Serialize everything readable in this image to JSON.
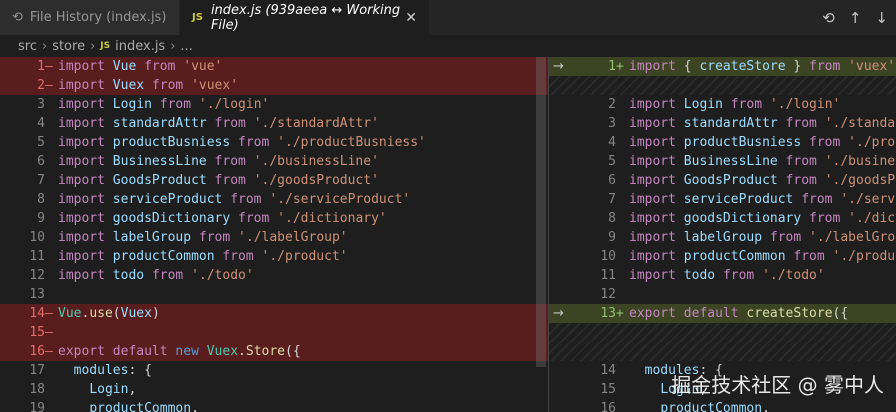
{
  "tabs": [
    {
      "label": "File History (index.js)",
      "icon": "history-icon",
      "active": false
    },
    {
      "label": "index.js (939aeea ↔ Working File)",
      "icon": "js-file-icon",
      "active": true
    }
  ],
  "breadcrumb": [
    "src",
    "store",
    "index.js",
    "..."
  ],
  "left_lines": [
    {
      "num": "1",
      "mark": "—",
      "type": "removed",
      "code": "import Vue from 'vue'"
    },
    {
      "num": "2",
      "mark": "—",
      "type": "removed",
      "code": "import Vuex from 'vuex'"
    },
    {
      "num": "3",
      "mark": "",
      "type": "normal",
      "code": "import Login from './login'"
    },
    {
      "num": "4",
      "mark": "",
      "type": "normal",
      "code": "import standardAttr from './standardAttr'"
    },
    {
      "num": "5",
      "mark": "",
      "type": "normal",
      "code": "import productBusniess from './productBusniess'"
    },
    {
      "num": "6",
      "mark": "",
      "type": "normal",
      "code": "import BusinessLine from './businessLine'"
    },
    {
      "num": "7",
      "mark": "",
      "type": "normal",
      "code": "import GoodsProduct from './goodsProduct'"
    },
    {
      "num": "8",
      "mark": "",
      "type": "normal",
      "code": "import serviceProduct from './serviceProduct'"
    },
    {
      "num": "9",
      "mark": "",
      "type": "normal",
      "code": "import goodsDictionary from './dictionary'"
    },
    {
      "num": "10",
      "mark": "",
      "type": "normal",
      "code": "import labelGroup from './labelGroup'"
    },
    {
      "num": "11",
      "mark": "",
      "type": "normal",
      "code": "import productCommon from './product'"
    },
    {
      "num": "12",
      "mark": "",
      "type": "normal",
      "code": "import todo from './todo'"
    },
    {
      "num": "13",
      "mark": "",
      "type": "normal",
      "code": ""
    },
    {
      "num": "14",
      "mark": "—",
      "type": "removed",
      "code": "Vue.use(Vuex)"
    },
    {
      "num": "15",
      "mark": "—",
      "type": "removed",
      "code": ""
    },
    {
      "num": "16",
      "mark": "—",
      "type": "removed",
      "code": "export default new Vuex.Store({"
    },
    {
      "num": "17",
      "mark": "",
      "type": "normal",
      "code": "  modules: {"
    },
    {
      "num": "18",
      "mark": "",
      "type": "normal",
      "code": "    Login,"
    },
    {
      "num": "19",
      "mark": "",
      "type": "normal",
      "code": "    productCommon,"
    }
  ],
  "right_lines": [
    {
      "num": "1",
      "mark": "+",
      "type": "added",
      "arrow": true,
      "code": "import { createStore } from 'vuex'"
    },
    {
      "num": "",
      "mark": "",
      "type": "filler",
      "arrow": false,
      "code": ""
    },
    {
      "num": "2",
      "mark": "",
      "type": "normal",
      "arrow": false,
      "code": "import Login from './login'"
    },
    {
      "num": "3",
      "mark": "",
      "type": "normal",
      "arrow": false,
      "code": "import standardAttr from './standardAttr'"
    },
    {
      "num": "4",
      "mark": "",
      "type": "normal",
      "arrow": false,
      "code": "import productBusniess from './productBusniess'"
    },
    {
      "num": "5",
      "mark": "",
      "type": "normal",
      "arrow": false,
      "code": "import BusinessLine from './businessLine'"
    },
    {
      "num": "6",
      "mark": "",
      "type": "normal",
      "arrow": false,
      "code": "import GoodsProduct from './goodsProduct'"
    },
    {
      "num": "7",
      "mark": "",
      "type": "normal",
      "arrow": false,
      "code": "import serviceProduct from './serviceProduct'"
    },
    {
      "num": "8",
      "mark": "",
      "type": "normal",
      "arrow": false,
      "code": "import goodsDictionary from './dictionary'"
    },
    {
      "num": "9",
      "mark": "",
      "type": "normal",
      "arrow": false,
      "code": "import labelGroup from './labelGroup'"
    },
    {
      "num": "10",
      "mark": "",
      "type": "normal",
      "arrow": false,
      "code": "import productCommon from './product'"
    },
    {
      "num": "11",
      "mark": "",
      "type": "normal",
      "arrow": false,
      "code": "import todo from './todo'"
    },
    {
      "num": "12",
      "mark": "",
      "type": "normal",
      "arrow": false,
      "code": ""
    },
    {
      "num": "13",
      "mark": "+",
      "type": "added",
      "arrow": true,
      "code": "export default createStore({"
    },
    {
      "num": "",
      "mark": "",
      "type": "filler",
      "arrow": false,
      "code": ""
    },
    {
      "num": "",
      "mark": "",
      "type": "filler",
      "arrow": false,
      "code": ""
    },
    {
      "num": "14",
      "mark": "",
      "type": "normal",
      "arrow": false,
      "code": "  modules: {"
    },
    {
      "num": "15",
      "mark": "",
      "type": "normal",
      "arrow": false,
      "code": "    Login,"
    },
    {
      "num": "16",
      "mark": "",
      "type": "normal",
      "arrow": false,
      "code": "    productCommon,"
    }
  ],
  "watermark": "掘金技术社区 @ 雾中人"
}
